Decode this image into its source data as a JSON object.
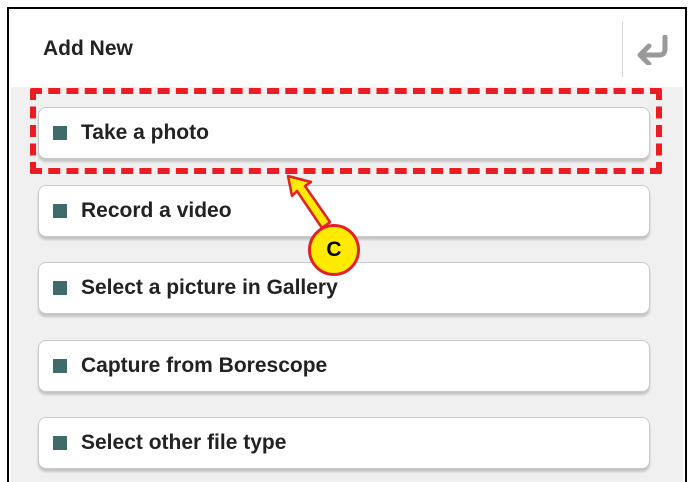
{
  "dialog": {
    "title": "Add New",
    "back_icon": "back-arrow-icon",
    "options": [
      {
        "label": "Take a photo"
      },
      {
        "label": "Record a video"
      },
      {
        "label": "Select a picture in Gallery"
      },
      {
        "label": "Capture from Borescope"
      },
      {
        "label": "Select other file type"
      }
    ]
  },
  "annotation": {
    "callout_letter": "C",
    "highlight_color": "#ea1c24",
    "callout_fill": "#ffea00"
  }
}
